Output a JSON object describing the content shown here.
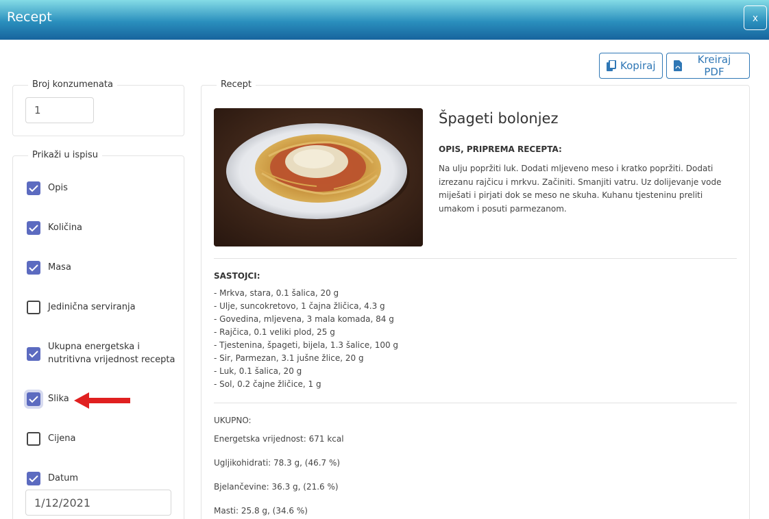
{
  "modal": {
    "title": "Recept",
    "close_label": "x"
  },
  "toolbar": {
    "copy_label": "Kopiraj",
    "pdf_label": "Kreiraj PDF"
  },
  "broj": {
    "legend": "Broj konzumenata",
    "value": "1"
  },
  "prikazi": {
    "legend": "Prikaži u ispisu",
    "options": [
      {
        "label": "Opis",
        "checked": true
      },
      {
        "label": "Količina",
        "checked": true
      },
      {
        "label": "Masa",
        "checked": true
      },
      {
        "label": "Jedinična serviranja",
        "checked": false
      },
      {
        "label": "Ukupna energetska i nutritivna vrijednost recepta",
        "checked": true
      },
      {
        "label": "Slika",
        "checked": true
      },
      {
        "label": "Cijena",
        "checked": false
      },
      {
        "label": "Datum",
        "checked": true
      }
    ],
    "datum_value": "1/12/2021"
  },
  "recept": {
    "legend": "Recept",
    "title": "Špageti bolonjez",
    "opis_heading": "OPIS, PRIPREMA RECEPTA:",
    "opis_text": "Na ulju popržiti luk. Dodati mljeveno meso i kratko popržiti. Dodati izrezanu rajčicu i mrkvu. Začiniti. Smanjiti vatru. Uz dolijevanje vode miješati i pirjati dok se meso ne skuha. Kuhanu tjesteninu preliti umakom i posuti parmezanom.",
    "sastojci_heading": "SASTOJCI:",
    "sastojci": [
      "- Mrkva, stara, 0.1 šalica, 20 g",
      "- Ulje, suncokretovo, 1 čajna žličica, 4.3 g",
      "- Govedina, mljevena, 3 mala komada, 84 g",
      "- Rajčica, 0.1 veliki plod, 25 g",
      "- Tjestenina, špageti, bijela, 1.3 šalice, 100 g",
      "- Sir, Parmezan, 3.1 jušne žlice, 20 g",
      "- Luk, 0.1 šalica, 20 g",
      "- Sol, 0.2 čajne žličice, 1 g"
    ],
    "ukupno_heading": "UKUPNO:",
    "nutrition": [
      "Energetska vrijednost: 671 kcal",
      "Ugljikohidrati: 78.3 g, (46.7 %)",
      "Bjelančevine: 36.3 g, (21.6 %)",
      "Masti: 25.8 g, (34.6 %)"
    ]
  },
  "colors": {
    "header_top": "#84dbe6",
    "header_bottom": "#17649d",
    "button_accent": "#2f77b5",
    "checkbox_checked": "#5c6bc0",
    "annotation_arrow": "#e02020"
  },
  "icons": {
    "copy": "copy-icon",
    "pdf": "file-pdf-icon",
    "check": "check-icon",
    "arrow": "arrow-left-icon"
  }
}
